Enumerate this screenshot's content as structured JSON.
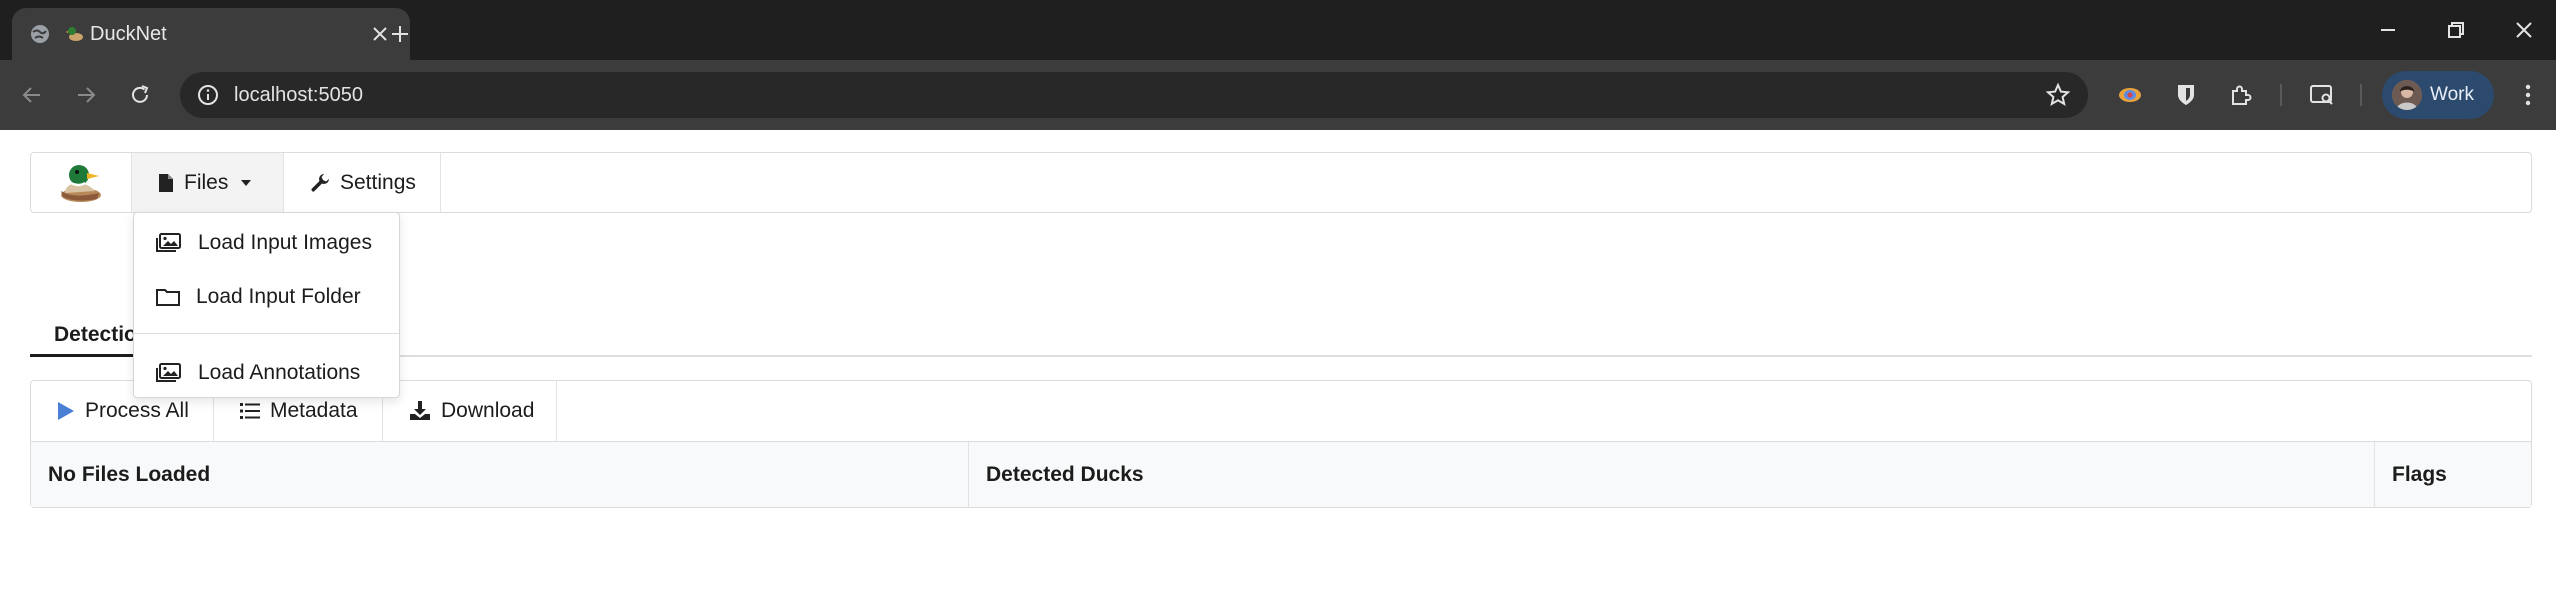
{
  "browser": {
    "tab_title": "DuckNet",
    "url": "localhost:5050",
    "profile_label": "Work"
  },
  "app": {
    "nav": {
      "files_label": "Files",
      "settings_label": "Settings"
    },
    "files_menu": {
      "items": [
        {
          "label": "Load Input Images",
          "icon": "images-icon"
        },
        {
          "label": "Load Input Folder",
          "icon": "folder-icon"
        },
        {
          "label": "Load Annotations",
          "icon": "images-icon"
        }
      ]
    },
    "tabs": {
      "active_label": "Detection"
    },
    "toolbar": {
      "process_all": "Process All",
      "metadata": "Metadata",
      "download": "Download"
    },
    "table": {
      "columns": [
        "No Files Loaded",
        "Detected Ducks",
        "Flags"
      ]
    }
  },
  "colors": {
    "process_icon": "#4a7fd6",
    "chrome_dark": "#1f1f1f",
    "chrome_toolbar": "#3c3c3c"
  }
}
